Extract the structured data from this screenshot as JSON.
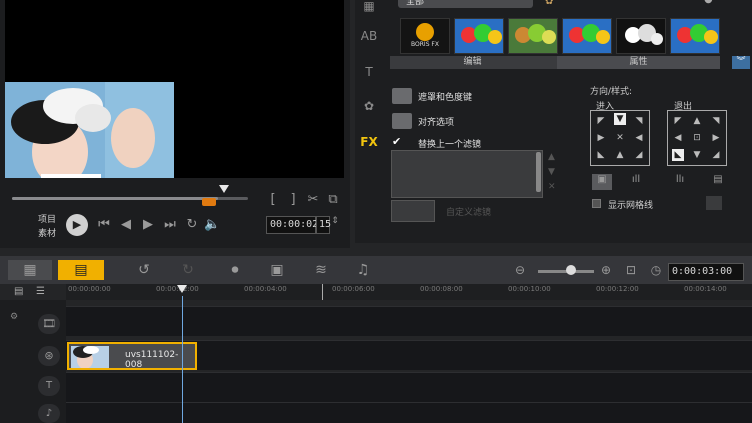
{
  "preview": {
    "label_project": "项目",
    "label_clip": "素材",
    "timecode": "00:00:02",
    "frame": "15"
  },
  "effects_panel": {
    "category_value": "全部",
    "gallery": [
      "BORIS FX",
      "balloons-1",
      "balloons-2",
      "balloons-3",
      "balloons-4",
      "balloons-5"
    ],
    "tabs": [
      "编辑",
      "属性"
    ],
    "options": {
      "mask_chroma": "遮罩和色度键",
      "align": "对齐选项",
      "replace_filter": "替换上一个滤镜",
      "custom_filter": "自定义滤镜",
      "direction_style": "方向/样式:",
      "enter": "进入",
      "exit": "退出",
      "show_grid": "显示网格线"
    },
    "fx_label": "FX"
  },
  "timeline": {
    "duration": "0:00:03:00",
    "ruler": [
      "00:00:00:00",
      "00:00:02:00",
      "00:00:04:00",
      "00:00:06:00",
      "00:00:08:00",
      "00:00:10:00",
      "00:00:12:00",
      "00:00:14:00"
    ],
    "clip_name": "uvs111102-008"
  },
  "colors": {
    "accent": "#f1b000",
    "trim": "#e07a10",
    "playhead": "#6fa8e0"
  }
}
